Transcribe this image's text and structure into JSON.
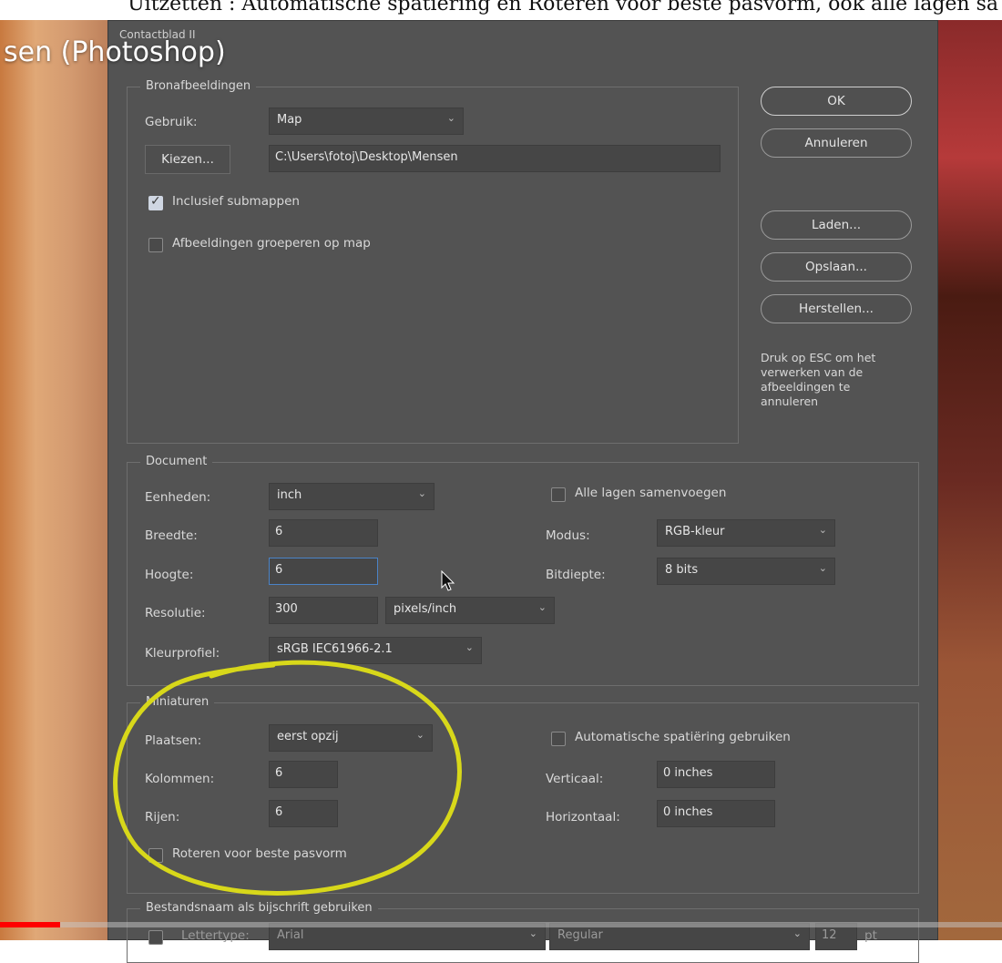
{
  "caption": "Uitzetten : Automatische spatiëring en Roteren  voor beste pasvorm, ook alle lagen sa",
  "video_title": "sen (Photoshop)",
  "dialog": {
    "title": "Contactblad II",
    "source": {
      "legend": "Bronafbeeldingen",
      "use_label": "Gebruik:",
      "use_value": "Map",
      "choose_button": "Kiezen...",
      "path_value": "C:\\Users\\fotoj\\Desktop\\Mensen",
      "include_subfolders_label": "Inclusief submappen",
      "include_subfolders_checked": true,
      "group_by_folder_label": "Afbeeldingen groeperen op map",
      "group_by_folder_checked": false
    },
    "buttons": {
      "ok": "OK",
      "cancel": "Annuleren",
      "load": "Laden...",
      "save": "Opslaan...",
      "reset": "Herstellen..."
    },
    "esc_note": "Druk op ESC om het verwerken van de afbeeldingen te annuleren",
    "document": {
      "legend": "Document",
      "units_label": "Eenheden:",
      "units_value": "inch",
      "width_label": "Breedte:",
      "width_value": "6",
      "height_label": "Hoogte:",
      "height_value": "6",
      "resolution_label": "Resolutie:",
      "resolution_value": "300",
      "resolution_unit": "pixels/inch",
      "profile_label": "Kleurprofiel:",
      "profile_value": "sRGB IEC61966-2.1",
      "flatten_label": "Alle lagen samenvoegen",
      "flatten_checked": false,
      "mode_label": "Modus:",
      "mode_value": "RGB-kleur",
      "bitdepth_label": "Bitdiepte:",
      "bitdepth_value": "8 bits"
    },
    "thumbnails": {
      "legend": "Miniaturen",
      "place_label": "Plaatsen:",
      "place_value": "eerst opzij",
      "columns_label": "Kolommen:",
      "columns_value": "6",
      "rows_label": "Rijen:",
      "rows_value": "6",
      "rotate_label": "Roteren voor beste pasvorm",
      "rotate_checked": false,
      "auto_spacing_label": "Automatische spatiëring gebruiken",
      "auto_spacing_checked": false,
      "vertical_label": "Verticaal:",
      "vertical_value": "0 inches",
      "horizontal_label": "Horizontaal:",
      "horizontal_value": "0 inches"
    },
    "caption_group": {
      "legend": "Bestandsnaam als bijschrift gebruiken",
      "font_label": "Lettertype:",
      "font_value": "Arial",
      "style_value": "Regular",
      "size_value": "12",
      "size_unit": "pt"
    }
  },
  "video": {
    "progress_fraction": 0.06
  },
  "colors": {
    "dialog_bg": "#535353",
    "annotation_circle": "#d8d81a",
    "progress": "#ff0000"
  }
}
